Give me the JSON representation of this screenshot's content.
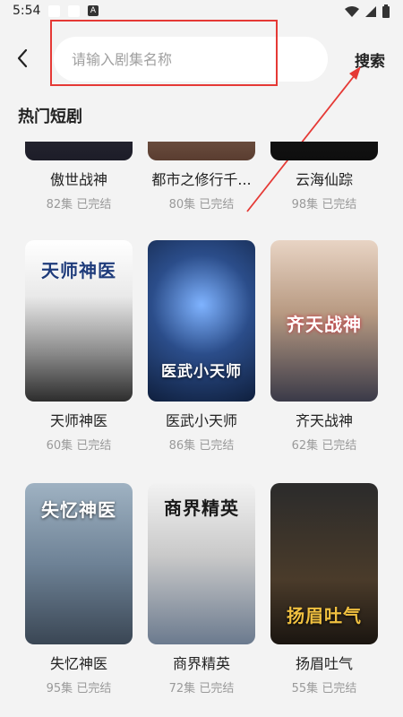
{
  "status": {
    "time": "5:54",
    "badge": "A"
  },
  "header": {
    "search_placeholder": "请输入剧集名称",
    "search_label": "搜索"
  },
  "section": {
    "title": "热门短剧"
  },
  "colors": {
    "annotation": "#e53935",
    "background": "#f3f3f3",
    "muted": "#9a9a9a"
  },
  "dramas": [
    {
      "name": "傲世战神",
      "episodes": "82集",
      "status": "已完结",
      "poster_text": ""
    },
    {
      "name": "都市之修行千...",
      "episodes": "80集",
      "status": "已完结",
      "poster_text": ""
    },
    {
      "name": "云海仙踪",
      "episodes": "98集",
      "status": "已完结",
      "poster_text": ""
    },
    {
      "name": "天师神医",
      "episodes": "60集",
      "status": "已完结",
      "poster_text": "天师神医"
    },
    {
      "name": "医武小天师",
      "episodes": "86集",
      "status": "已完结",
      "poster_text": "医武小天师"
    },
    {
      "name": "齐天战神",
      "episodes": "62集",
      "status": "已完结",
      "poster_text": "齐天战神"
    },
    {
      "name": "失忆神医",
      "episodes": "95集",
      "status": "已完结",
      "poster_text": "失忆神医"
    },
    {
      "name": "商界精英",
      "episodes": "72集",
      "status": "已完结",
      "poster_text": "商界精英"
    },
    {
      "name": "扬眉吐气",
      "episodes": "55集",
      "status": "已完结",
      "poster_text": "扬眉吐气"
    }
  ]
}
